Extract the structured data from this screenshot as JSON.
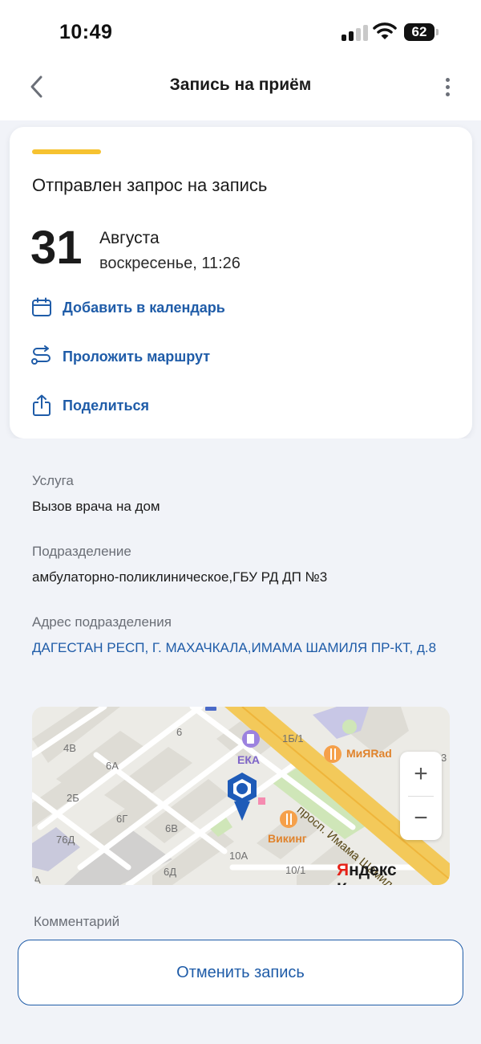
{
  "status_bar": {
    "time": "10:49",
    "battery": "62"
  },
  "header": {
    "title": "Запись на приём",
    "back_icon": "chevron-left-icon",
    "more_icon": "more-vertical-icon"
  },
  "status_card": {
    "title": "Отправлен запрос на запись",
    "accent_color": "#f6c230",
    "day": "31",
    "month": "Августа",
    "weekday_time": "воскресенье, 11:26",
    "actions": [
      {
        "label": "Добавить в календарь",
        "icon": "calendar-icon"
      },
      {
        "label": "Проложить маршрут",
        "icon": "route-icon"
      },
      {
        "label": "Поделиться",
        "icon": "share-icon"
      }
    ]
  },
  "details": {
    "service_label": "Услуга",
    "service_value": "Вызов врача на дом",
    "department_label": "Подразделение",
    "department_value": "амбулаторно-поликлиническое,ГБУ РД ДП №3",
    "address_label": "Адрес подразделения",
    "address_value": "ДАГЕСТАН РЕСП, Г. МАХАЧКАЛА,ИМАМА ШАМИЛЯ ПР-КТ, д.8",
    "comment_label": "Комментарий"
  },
  "map": {
    "street_label": "просп. Имама Шамиля",
    "poi_eka": "ЕКА",
    "poi_muyarad": "МиЯRad",
    "poi_viking": "Викинг",
    "logo_yandex_first": "Я",
    "logo_yandex_rest": "ндекс Карты",
    "zoom_in": "+",
    "zoom_out": "−",
    "house_labels": [
      "4В",
      "6А",
      "6",
      "1Б/1",
      "2Б",
      "6Г",
      "6В",
      "76Д",
      "6Д",
      "10А",
      "10/1",
      "А",
      "3"
    ]
  },
  "footer": {
    "cancel_label": "Отменить запись"
  },
  "colors": {
    "link": "#1f5ca8",
    "background": "#f1f3f8",
    "road": "#f3c95a",
    "pin": "#1e5bb8"
  }
}
